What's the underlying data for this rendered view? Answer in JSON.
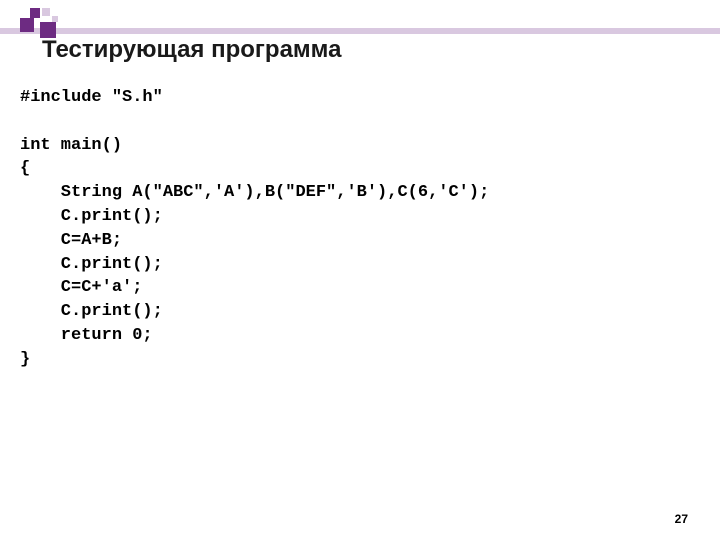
{
  "title": "Тестирующая программа",
  "code": {
    "l1": "#include \"S.h\"",
    "l2": "",
    "l3": "int main()",
    "l4": "{",
    "l5": "    String A(\"ABC\",'A'),B(\"DEF\",'B'),C(6,'C');",
    "l6": "    C.print();",
    "l7": "    C=A+B;",
    "l8": "    C.print();",
    "l9": "    C=C+'a';",
    "l10": "    C.print();",
    "l11": "    return 0;",
    "l12": "}"
  },
  "page_number": "27"
}
